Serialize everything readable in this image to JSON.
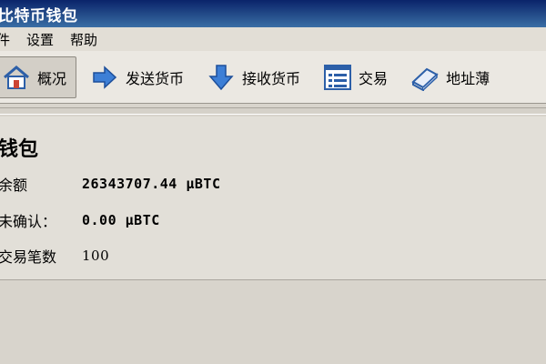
{
  "window": {
    "title": "比特币钱包"
  },
  "menu": {
    "file": "件",
    "settings": "设置",
    "help": "帮助"
  },
  "toolbar": {
    "overview": "概况",
    "send": "发送货币",
    "receive": "接收货币",
    "transactions": "交易",
    "address_book": "地址薄"
  },
  "wallet": {
    "title": "钱包",
    "balance_label": "余额",
    "balance_value": "26343707.44 µBTC",
    "unconfirmed_label": "未确认：",
    "unconfirmed_value": "0.00 µBTC",
    "tx_count_label": "交易笔数",
    "tx_count_value": "100"
  },
  "colors": {
    "titlebar_start": "#0a246a",
    "titlebar_end": "#3a6ea5",
    "window_bg": "#d8d4cc"
  },
  "icons": {
    "overview": "house-icon",
    "send": "arrow-right-icon",
    "receive": "arrow-down-icon",
    "transactions": "list-icon",
    "address_book": "book-icon"
  }
}
